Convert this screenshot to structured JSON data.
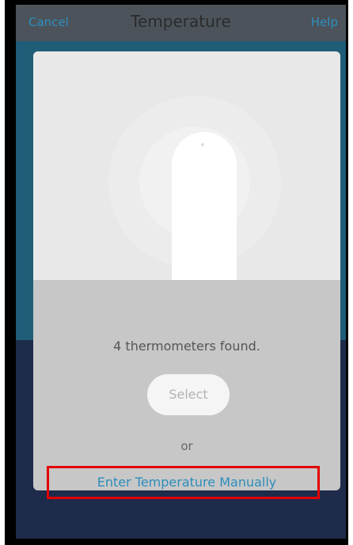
{
  "nav": {
    "cancel_label": "Cancel",
    "title": "Temperature",
    "help_label": "Help"
  },
  "card": {
    "illustration_icon": "thermometer-icon",
    "found_text": "4 thermometers found.",
    "select_label": "Select",
    "or_text": "or",
    "manual_entry_label": "Enter Temperature Manually"
  },
  "colors": {
    "link": "#2d8dbb",
    "highlight_border": "#e30000",
    "top_background": "#1f5d78",
    "bottom_background": "#1f2b4a"
  }
}
